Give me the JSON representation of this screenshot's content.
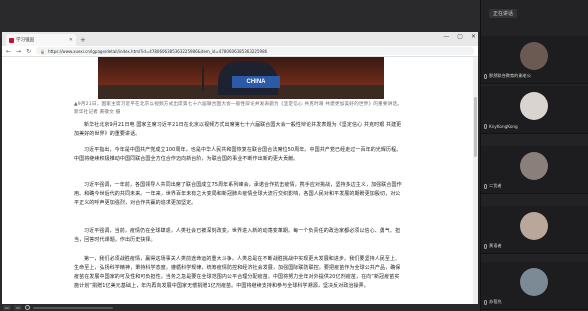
{
  "browser": {
    "tab_title": "学习强国",
    "new_tab": "+",
    "window_controls": [
      "—",
      "▢",
      "✕"
    ],
    "nav": [
      "←",
      "→",
      "↻"
    ],
    "url": "https://www.xuexi.cn/lgpage/detail/index.html?id=4780606385363225986&item_id=4780606385363225986"
  },
  "article": {
    "photo_sign": "CHINA",
    "caption": "▲9月21日，国家主席习近平在北京以视频方式出席第七十六届联合国大会一般性辩论并发表题为《坚定信心 共克时艰 共建更加美好的世界》的重要讲话。 新华社记者 黄敬文 摄",
    "paragraphs": [
      "新华社北京9月21日电 国家主席习近平21日在北京以视频方式出席第七十六届联合国大会一般性辩论并发表题为《坚定信心 共克时艰 共建更加美好的世界》的重要讲话。",
      "习近平指出，今年是中国共产党成立100周年，也是中华人民共和国恢复在联合国合法席位50周年。中国共产党已经走过一百年的光辉历程。中国将继续积极推动中国同联合国全方位合作迈向新台阶，为联合国的事业不断作出新的更大贡献。",
      "习近平强调，一年前，各国领导人共同出席了联合国成立75周年系列峰会，承诺合作抗击疫情，携手应对挑战，坚持多边主义，加强联合国作用。和确今世后代的共同未来。一年来，世界百年未有之大变局和新冠肺炎疫情全球大流行交织影响，各国人民对和平发展的期盼更加殷切，对公平正义的呼声更加强烈，对合作共赢的追求更加坚定。",
      "习近平强调，当前，疫情仍在全球肆虐，人类社会已被深刻改变。世界进入新的动荡变革期。每一个负责任的政治家都必须以信心、勇气、担当，回答时代课题，作出历史抉择。",
      "第一，我们必须战胜疫情，赢得这场事关人类前途命运的重大斗争。人类总是在不断战胜挑战中实现更大发展和进步。我们要坚持人民至上、生命至上，弘扬科学精神，秉持科学态度，遵循科学规律，统筹疫情防控和经济社会发展，加强国际联防联控。要把疫苗作为全球公共产品，确保疫苗在发展中国家的可及性和可负担性。当务之急是要在全球范围内公平合理分配疫苗。中国将努力全年对外提供20亿剂疫苗，在向“新冠疫苗实施计划”捐赠1亿美元基础上，年内再向发展中国家无偿捐赠1亿剂疫苗。中国将继续支持和参与全球科学溯源，坚决反对政治操弄。"
    ]
  },
  "controls": {
    "buttons": [
      "▭",
      "▭"
    ]
  },
  "panel": {
    "speaking_label": "正在讲话",
    "participants": [
      {
        "name": "那然联合教育的谢老公"
      },
      {
        "name": "KnyKongKong"
      },
      {
        "name": "二货者"
      },
      {
        "name": "黄语者"
      },
      {
        "name": "苏蓓兆"
      }
    ]
  }
}
